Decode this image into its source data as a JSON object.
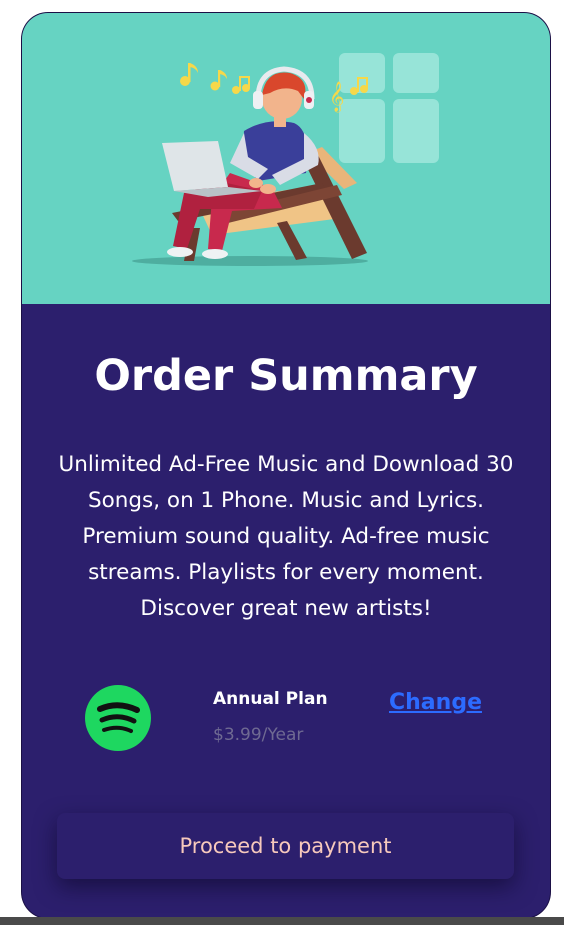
{
  "card": {
    "title": "Order Summary",
    "description": "Unlimited Ad-Free Music and Download 30 Songs, on 1 Phone. Music and Lyrics. Premium sound quality. Ad-free music streams. Playlists for every moment. Discover great new artists!"
  },
  "plan": {
    "icon": "spotify-icon",
    "name": "Annual Plan",
    "price": "$3.99/Year",
    "change_label": "Change"
  },
  "actions": {
    "proceed_label": "Proceed to payment"
  },
  "colors": {
    "hero_bg": "#66d3c2",
    "card_bg": "#2c1f6d",
    "link": "#2c6bff",
    "button_text": "#f7c9bc",
    "spotify_green": "#1ed760"
  }
}
